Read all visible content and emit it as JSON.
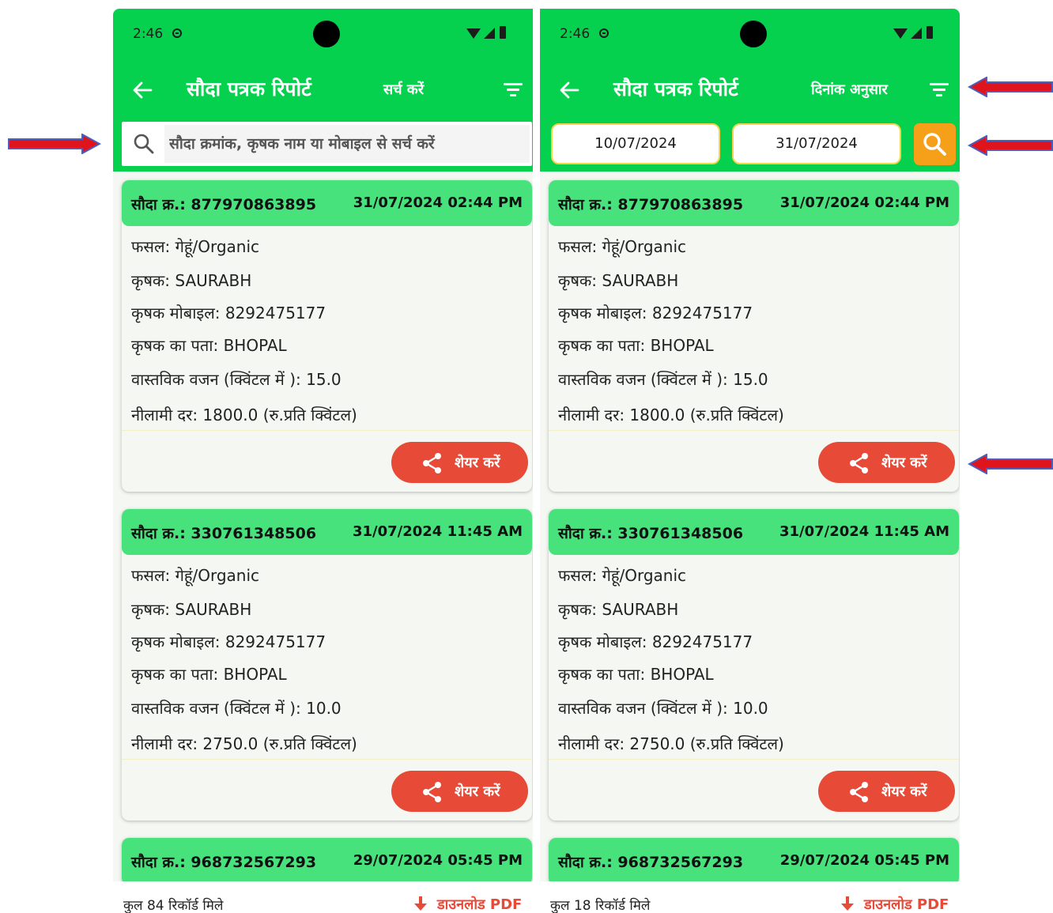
{
  "status": {
    "time": "2:46"
  },
  "left_screen": {
    "title": "सौदा पत्रक रिपोर्ट",
    "action_label": "सर्च करें",
    "search_placeholder": "सौदा क्रमांक, कृषक नाम या मोबाइल से सर्च करें",
    "total_records": "कुल 84 रिकॉर्ड मिले",
    "download_label": "डाउनलोड PDF"
  },
  "right_screen": {
    "title": "सौदा पत्रक रिपोर्ट",
    "action_label": "दिनांक अनुसार",
    "from_date": "10/07/2024",
    "to_date": "31/07/2024",
    "total_records": "कुल 18 रिकॉर्ड मिले",
    "download_label": "डाउनलोड PDF"
  },
  "share_label": "शेयर करें",
  "cards": [
    {
      "number": "सौदा क्र.: 877970863895",
      "datetime": "31/07/2024 02:44 PM",
      "crop": "फसल: गेहूं/Organic",
      "farmer": "कृषक: SAURABH",
      "mobile": "कृषक मोबाइल: 8292475177",
      "address": "कृषक का पता: BHOPAL",
      "weight": "वास्तविक वजन (क्विंटल में ): 15.0",
      "rate": "नीलामी दर: 1800.0 (रु.प्रति क्विंटल)"
    },
    {
      "number": "सौदा क्र.: 330761348506",
      "datetime": "31/07/2024 11:45 AM",
      "crop": "फसल: गेहूं/Organic",
      "farmer": "कृषक: SAURABH",
      "mobile": "कृषक मोबाइल: 8292475177",
      "address": "कृषक का पता: BHOPAL",
      "weight": "वास्तविक वजन (क्विंटल में ): 10.0",
      "rate": "नीलामी दर: 2750.0 (रु.प्रति क्विंटल)"
    },
    {
      "number": "सौदा क्र.: 968732567293",
      "datetime": "29/07/2024 05:45 PM"
    }
  ],
  "colors": {
    "app_green": "#06d14f",
    "card_header_green": "#48e27d",
    "share_red": "#e84a38",
    "search_orange": "#f6a01a",
    "annotation_red": "#e0141c",
    "annotation_blue": "#4a5fbf"
  },
  "icons": [
    "back-arrow-icon",
    "filter-icon",
    "search-icon",
    "share-icon",
    "download-arrow-icon"
  ]
}
